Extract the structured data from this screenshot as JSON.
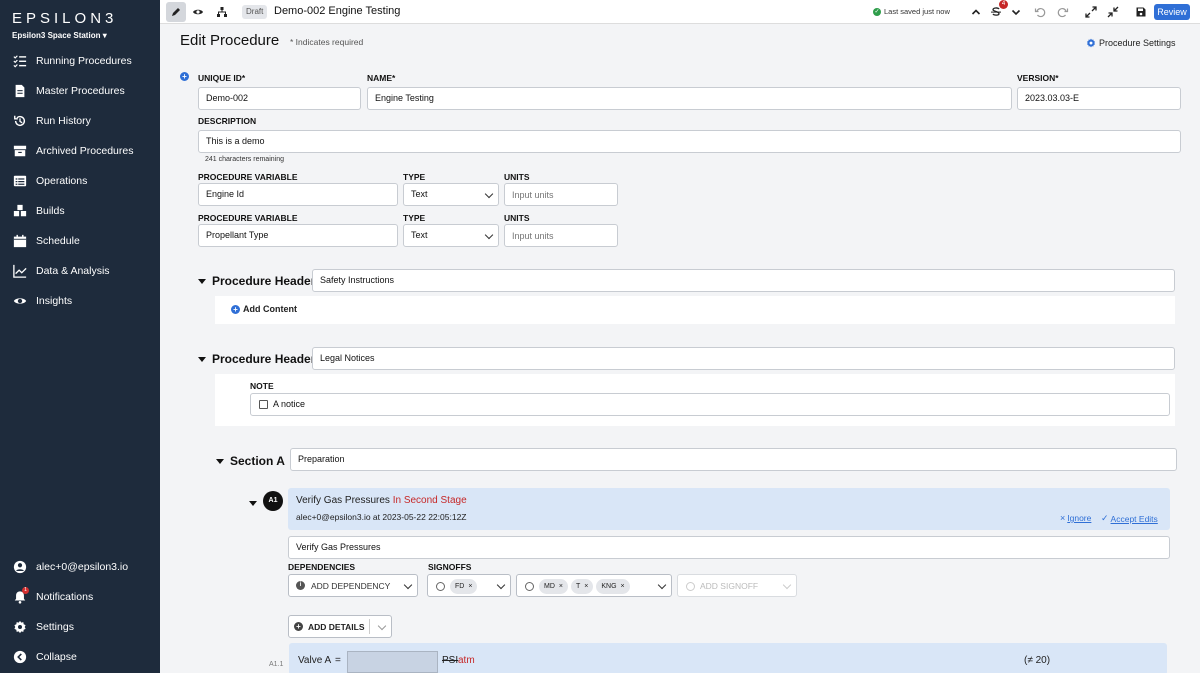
{
  "sidebar": {
    "brand": "EPSILON3",
    "station": "Epsilon3 Space Station ▾",
    "items": [
      {
        "label": "Running Procedures",
        "icon": "list-check-icon"
      },
      {
        "label": "Master Procedures",
        "icon": "document-icon"
      },
      {
        "label": "Run History",
        "icon": "history-icon"
      },
      {
        "label": "Archived Procedures",
        "icon": "archive-icon"
      },
      {
        "label": "Operations",
        "icon": "operations-icon"
      },
      {
        "label": "Builds",
        "icon": "cubes-icon"
      },
      {
        "label": "Schedule",
        "icon": "calendar-icon"
      },
      {
        "label": "Data & Analysis",
        "icon": "chart-line-icon"
      },
      {
        "label": "Insights",
        "icon": "eye-icon"
      }
    ],
    "bottom": [
      {
        "label": "alec+0@epsilon3.io",
        "icon": "user-icon"
      },
      {
        "label": "Notifications",
        "icon": "bell-icon",
        "badge": "1"
      },
      {
        "label": "Settings",
        "icon": "gear-icon"
      },
      {
        "label": "Collapse",
        "icon": "chevron-left-icon"
      }
    ]
  },
  "topbar": {
    "status": "Draft",
    "title": "Demo-002 Engine Testing",
    "saved": "Last saved just now",
    "changes_badge": "4",
    "review": "Review"
  },
  "page": {
    "title": "Edit Procedure",
    "required_note": "* Indicates required",
    "settings_link": "Procedure Settings"
  },
  "form": {
    "unique_id_label": "UNIQUE ID*",
    "unique_id": "Demo-002",
    "name_label": "NAME*",
    "name": "Engine Testing",
    "version_label": "VERSION*",
    "version": "2023.03.03-E",
    "description_label": "DESCRIPTION",
    "description": "This is a demo",
    "chars_remaining": "241 characters remaining",
    "variables": [
      {
        "label": "PROCEDURE VARIABLE",
        "value": "Engine Id",
        "type_label": "TYPE",
        "type": "Text",
        "units_label": "UNITS",
        "units_placeholder": "Input units"
      },
      {
        "label": "PROCEDURE VARIABLE",
        "value": "Propellant Type",
        "type_label": "TYPE",
        "type": "Text",
        "units_label": "UNITS",
        "units_placeholder": "Input units"
      }
    ]
  },
  "headers": [
    {
      "label": "Procedure Header",
      "value": "Safety Instructions",
      "add_content": "Add Content"
    },
    {
      "label": "Procedure Header",
      "value": "Legal Notices",
      "note_label": "NOTE",
      "note": "A notice"
    }
  ],
  "section": {
    "label": "Section A",
    "value": "Preparation",
    "step": {
      "badge": "A1",
      "title": "Verify Gas Pressures",
      "title_added": "In Second Stage",
      "author": "alec+0@epsilon3.io at 2023-05-22 22:05:12Z",
      "ignore": "Ignore",
      "accept": "Accept Edits",
      "name_value": "Verify Gas Pressures",
      "dependencies_label": "DEPENDENCIES",
      "add_dependency": "ADD DEPENDENCY",
      "signoffs_label": "SIGNOFFS",
      "signoff_group1": [
        "FD"
      ],
      "signoff_group2": [
        "MD",
        "T",
        "KNG"
      ],
      "add_signoff": "ADD SIGNOFF",
      "add_details": "ADD DETAILS",
      "substep_id": "A1.1",
      "valve_label": "Valve A",
      "equals": "=",
      "unit_old": "PSI",
      "unit_new": "atm",
      "rule": "(≠ 20)"
    }
  },
  "colors": {
    "sidebar_bg": "#1e2b3c",
    "accent": "#2f6fd6",
    "added_text": "#c62828",
    "step_bg": "#d9e6f7"
  }
}
